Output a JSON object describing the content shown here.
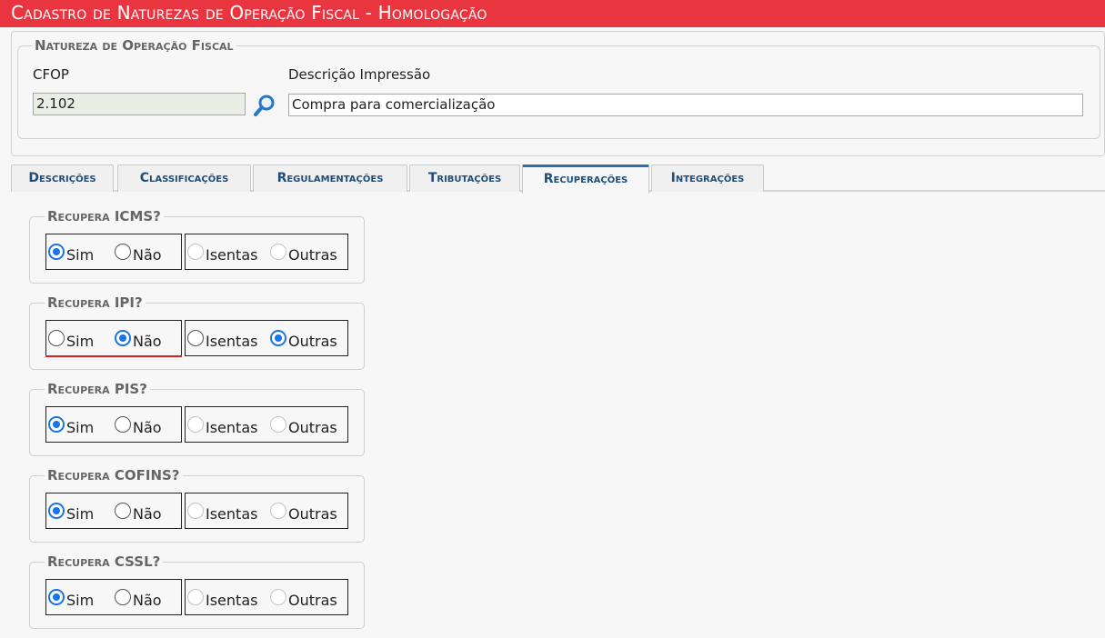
{
  "header": {
    "title": "Cadastro de Naturezas de Operação Fiscal  - Homologação"
  },
  "natureza": {
    "legend": "Natureza de Operação Fiscal",
    "cfop_label": "CFOP",
    "cfop_value": "2.102",
    "descricao_label": "Descrição Impressão",
    "descricao_value": "Compra para comercialização"
  },
  "tabs": [
    {
      "label": "Descrições",
      "active": false
    },
    {
      "label": "Classificações",
      "active": false
    },
    {
      "label": "Regulamentações",
      "active": false
    },
    {
      "label": "Tributações",
      "active": false
    },
    {
      "label": "Recuperações",
      "active": true
    },
    {
      "label": "Integrações",
      "active": false
    }
  ],
  "groups": [
    {
      "legend": "Recupera ICMS?",
      "sim": "Sim",
      "nao": "Não",
      "isentas": "Isentas",
      "outras": "Outras",
      "selected": "Sim",
      "sub_selected": null,
      "sub_enabled": false,
      "highlight": false
    },
    {
      "legend": "Recupera IPI?",
      "sim": "Sim",
      "nao": "Não",
      "isentas": "Isentas",
      "outras": "Outras",
      "selected": "Não",
      "sub_selected": "Outras",
      "sub_enabled": true,
      "highlight": true
    },
    {
      "legend": "Recupera PIS?",
      "sim": "Sim",
      "nao": "Não",
      "isentas": "Isentas",
      "outras": "Outras",
      "selected": "Sim",
      "sub_selected": null,
      "sub_enabled": false,
      "highlight": false
    },
    {
      "legend": "Recupera COFINS?",
      "sim": "Sim",
      "nao": "Não",
      "isentas": "Isentas",
      "outras": "Outras",
      "selected": "Sim",
      "sub_selected": null,
      "sub_enabled": false,
      "highlight": false
    },
    {
      "legend": "Recupera CSSL?",
      "sim": "Sim",
      "nao": "Não",
      "isentas": "Isentas",
      "outras": "Outras",
      "selected": "Sim",
      "sub_selected": null,
      "sub_enabled": false,
      "highlight": false
    }
  ],
  "colors": {
    "header_bg": "#e8353f",
    "tab_text": "#1f4e78",
    "radio_checked": "#1a73e8",
    "error_underline": "#e02020"
  },
  "icons": {
    "search": "search-icon"
  }
}
